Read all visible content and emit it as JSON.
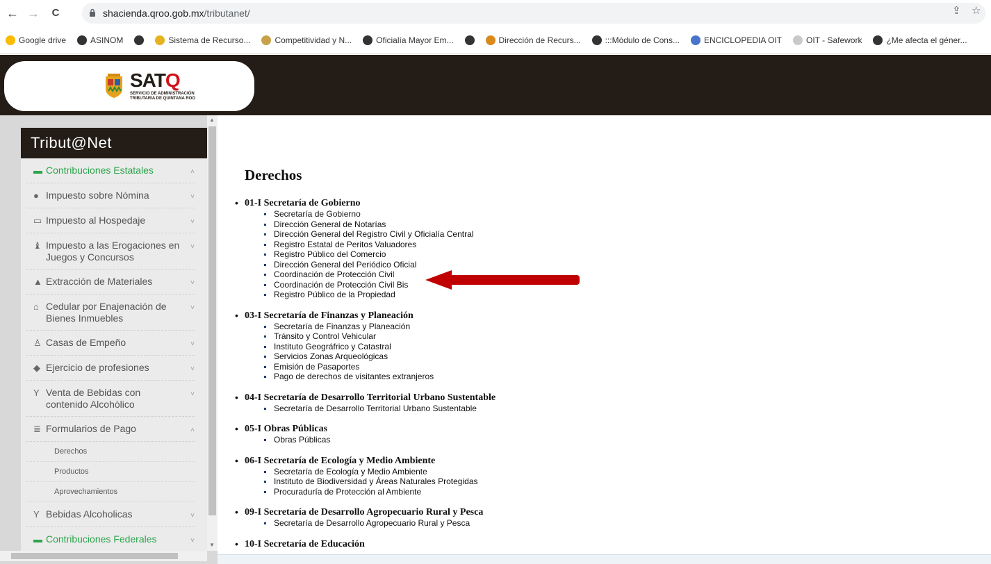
{
  "browser": {
    "url_domain": "shacienda.qroo.gob.mx",
    "url_path": "/tributanet/",
    "nav": {
      "back": "←",
      "forward": "→",
      "reload": "C"
    },
    "share_icon": "share-icon",
    "star_icon": "star-icon"
  },
  "bookmarks": [
    {
      "label": "Google drive",
      "color": "#fbbc04"
    },
    {
      "label": "ASINOM",
      "color": "#333333"
    },
    {
      "label": "",
      "color": "#333333"
    },
    {
      "label": "Sistema de Recurso...",
      "color": "#e5b31c"
    },
    {
      "label": "Competitividad y N...",
      "color": "#c8a24a"
    },
    {
      "label": "Oficialía Mayor Em...",
      "color": "#333333"
    },
    {
      "label": "",
      "color": "#333333"
    },
    {
      "label": "Dirección de Recurs...",
      "color": "#d98a1c"
    },
    {
      "label": ":::Módulo de Cons...",
      "color": "#333333"
    },
    {
      "label": "ENCICLOPEDIA OIT",
      "color": "#4a74c9"
    },
    {
      "label": "OIT - Safework",
      "color": "#c9c9c9"
    },
    {
      "label": "¿Me afecta el géner...",
      "color": "#333333"
    }
  ],
  "header": {
    "logo_text": "SAT",
    "logo_q": "Q",
    "logo_sub1": "SERVICIO DE ADMINISTRACIÓN",
    "logo_sub2": "TRIBUTARIA DE QUINTANA ROO",
    "header_bg": "#231c17"
  },
  "sidebar": {
    "title": "Tribut@Net",
    "items": [
      {
        "label": "Contribuciones Estatales",
        "icon": "folder-open-icon",
        "caret": "˄",
        "accent": "#2aa34a"
      },
      {
        "label": "Impuesto sobre Nómina",
        "icon": "user-icon",
        "caret": "˅"
      },
      {
        "label": "Impuesto al Hospedaje",
        "icon": "bed-icon",
        "caret": "˅"
      },
      {
        "label": "Impuesto a las Erogaciones en",
        "label2": "Juegos y Concursos",
        "icon": "chess-icon",
        "caret": "˅"
      },
      {
        "label": "Extracción de Materiales",
        "icon": "tree-icon",
        "caret": "˅"
      },
      {
        "label": "Cedular por Enajenación de",
        "label2": "Bienes Inmuebles",
        "icon": "home-icon",
        "caret": "˅"
      },
      {
        "label": "Casas de Empeño",
        "icon": "pawn-icon",
        "caret": "˅"
      },
      {
        "label": "Ejercicio de profesiones",
        "icon": "graduation-cap-icon",
        "caret": "˅"
      },
      {
        "label": "Venta de Bebidas con",
        "label2": "contenido Alcohòlico",
        "icon": "glass-icon",
        "caret": "˅"
      },
      {
        "label": "Formularios de Pago",
        "icon": "list-icon",
        "caret": "˄"
      }
    ],
    "sub_items": [
      "Derechos",
      "Productos",
      "Aprovechamientos"
    ],
    "after_items": [
      {
        "label": "Bebidas Alcoholicas",
        "icon": "glass-icon",
        "caret": "˅"
      },
      {
        "label": "Contribuciones Federales",
        "icon": "folder-open-icon",
        "caret": "˅",
        "accent": "#2aa34a"
      }
    ]
  },
  "main": {
    "title": "Derechos",
    "departments": [
      {
        "title": "01-I Secretaría de Gobierno",
        "items": [
          "Secretaría de Gobierno",
          "Dirección General de Notarías",
          "Dirección General del Registro Civil y Oficialía Central",
          "Registro Estatal de Peritos Valuadores",
          "Registro Público del Comercio",
          "Dirección General del Periódico Oficial",
          "Coordinación de Protección Civil",
          "Coordinación de Protección Civil Bis",
          "Registro Público de la Propiedad"
        ]
      },
      {
        "title": "03-I Secretaría de Finanzas y Planeación",
        "items": [
          "Secretaría de Finanzas y Planeación",
          "Tránsito y Control Vehicular",
          "Instituto Geográfrico y Catastral",
          "Servicios Zonas Arqueológicas",
          "Emisión de Pasaportes",
          "Pago de derechos de visitantes extranjeros"
        ]
      },
      {
        "title": "04-I Secretaría de Desarrollo Territorial Urbano Sustentable",
        "items": [
          "Secretaría de Desarrollo Territorial Urbano Sustentable"
        ]
      },
      {
        "title": "05-I Obras Públicas",
        "items": [
          "Obras Públicas"
        ]
      },
      {
        "title": "06-I Secretaría de Ecología y Medio Ambiente",
        "items": [
          "Secretaría de Ecología y Medio Ambiente",
          "Instituto de Biodiversidad y Áreas Naturales Protegidas",
          "Procuraduría de Protección al Ambiente"
        ]
      },
      {
        "title": "09-I Secretaría de Desarrollo Agropecuario Rural y Pesca",
        "items": [
          "Secretaría de Desarrollo Agropecuario Rural y Pesca"
        ]
      },
      {
        "title": "10-I Secretaría de Educación",
        "items": []
      }
    ],
    "annotation_arrow_color": "#c00000"
  }
}
